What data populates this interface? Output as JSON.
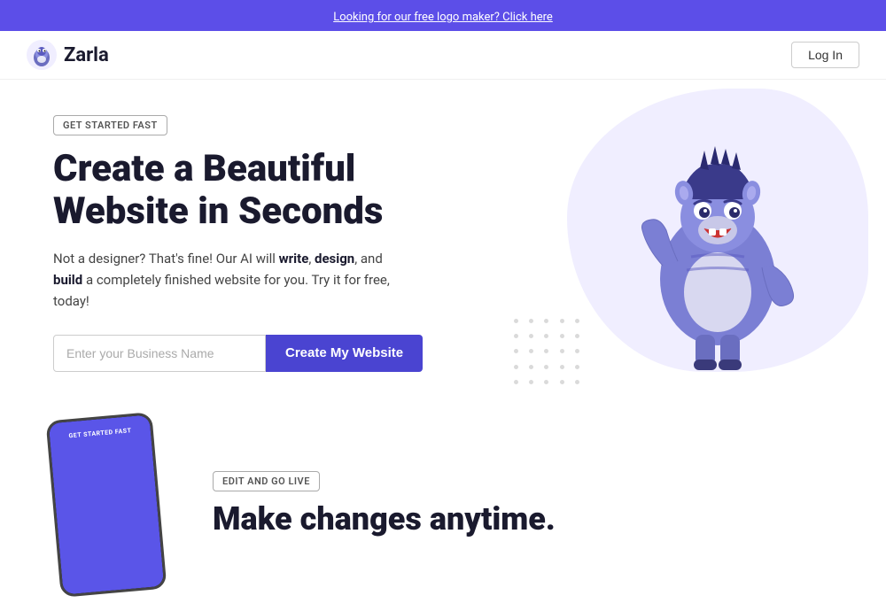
{
  "banner": {
    "text": "Looking for our free logo maker? Click here",
    "link": "Looking for our free logo maker? Click here"
  },
  "navbar": {
    "logo_text": "Zarla",
    "login_label": "Log In"
  },
  "hero": {
    "badge": "GET STARTED FAST",
    "title_line1": "Create a Beautiful",
    "title_line2": "Website in Seconds",
    "subtitle": "Not a designer? That's fine! Our AI will write, design, and build a completely finished website for you. Try it for free, today!",
    "input_placeholder": "Enter your Business Name",
    "button_label": "Create My Website"
  },
  "second_section": {
    "badge": "EDIT AND GO LIVE",
    "title": "Make changes anytime."
  }
}
